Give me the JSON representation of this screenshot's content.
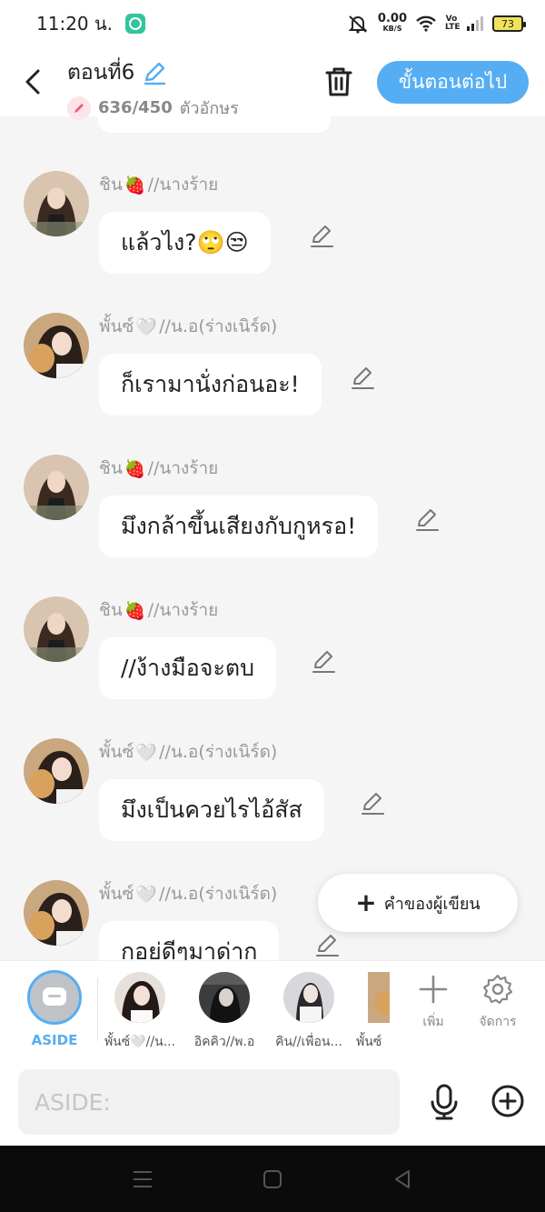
{
  "status_bar": {
    "time": "11:20 น.",
    "speed_value": "0.00",
    "speed_unit": "KB/S",
    "network": "Vo LTE",
    "battery": "73"
  },
  "header": {
    "title": "ตอนที่6",
    "char_count": "636/450",
    "char_unit": "ตัวอักษร",
    "next_button": "ขั้นตอนต่อไป"
  },
  "messages": [
    {
      "name": "ชิน",
      "emoji": "🍓",
      "role": "//นางร้าย",
      "text": "แล้วไง?🙄😒"
    },
    {
      "name": "พั้นซ์",
      "emoji": "🤍",
      "role": "//น.อ(ร่างเนิร์ด)",
      "text": "ก็เรามานั่งก่อนอะ!"
    },
    {
      "name": "ชิน",
      "emoji": "🍓",
      "role": "//นางร้าย",
      "text": "มึงกล้าขึ้นเสียงกับกูหรอ!"
    },
    {
      "name": "ชิน",
      "emoji": "🍓",
      "role": "//นางร้าย",
      "text": "//ง้างมือจะตบ"
    },
    {
      "name": "พั้นซ์",
      "emoji": "🤍",
      "role": "//น.อ(ร่างเนิร์ด)",
      "text": "มึงเป็นควยไรไอ้สัส"
    },
    {
      "name": "พั้นซ์",
      "emoji": "🤍",
      "role": "//น.อ(ร่างเนิร์ด)",
      "text": "กอยู่ดีๆมาด่าก"
    }
  ],
  "fab": {
    "label": "คำของผู้เขียน"
  },
  "character_bar": {
    "aside_label": "ASIDE",
    "characters": [
      {
        "label": "พั้นซ์🤍//น..."
      },
      {
        "label": "อิคคิว//พ.อ"
      },
      {
        "label": "คิน//เพื่อน..."
      },
      {
        "label": "พั้นซ์"
      }
    ],
    "add_label": "เพิ่ม",
    "settings_label": "จัดการ"
  },
  "input": {
    "placeholder": "ASIDE:"
  },
  "colors": {
    "accent": "#55aef3",
    "background": "#f5f5f5"
  }
}
